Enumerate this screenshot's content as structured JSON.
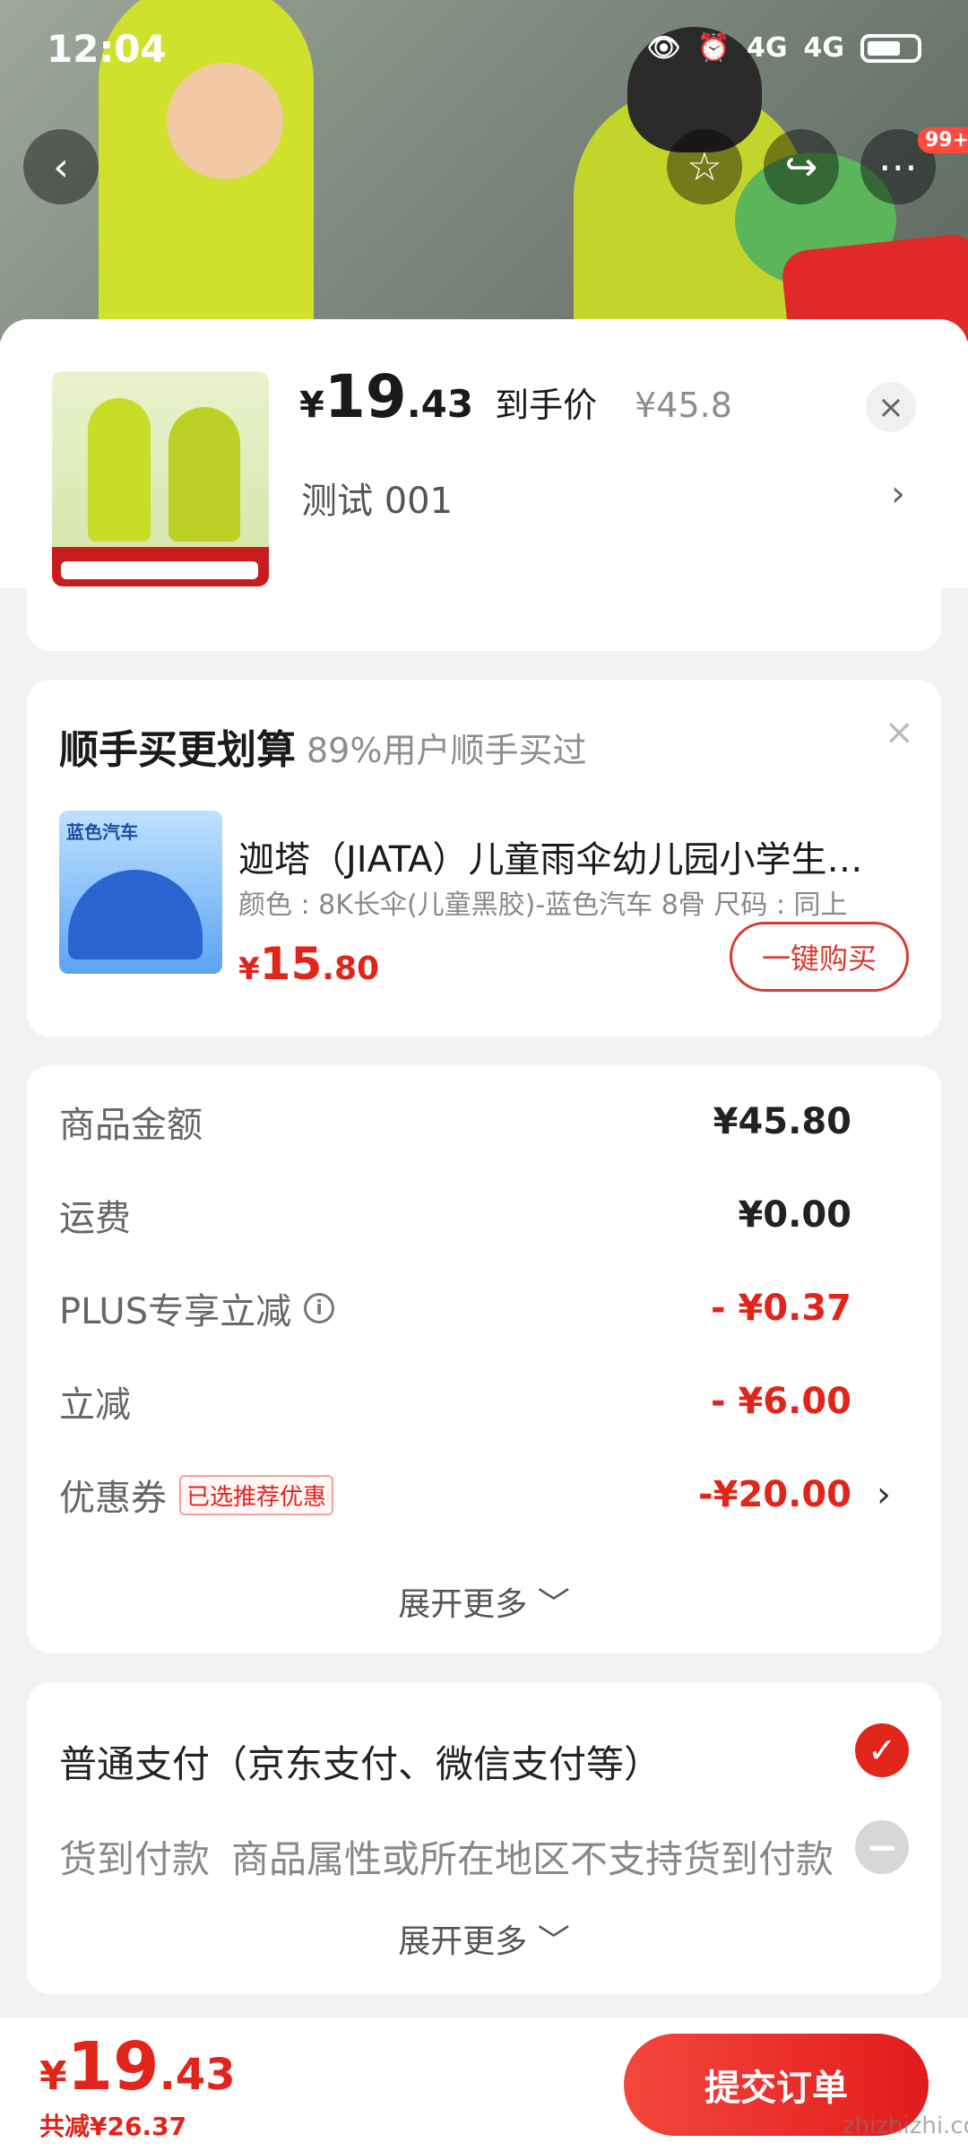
{
  "status_bar": {
    "time": "12:04",
    "network1": "4G",
    "network2": "4G"
  },
  "header": {
    "notification_badge": "99+"
  },
  "product": {
    "yen": "¥",
    "price_int": "19",
    "price_dec": ".43",
    "price_label": "到手价",
    "original_price": "¥45.8",
    "spec": "测试  001",
    "close": "×",
    "spec_arrow": "›"
  },
  "upsell": {
    "title": "顺手买更划算",
    "subtitle": "89%用户顺手买过",
    "close": "×",
    "image_text": "蓝色汽车",
    "name": "迦塔（JIATA）儿童雨伞幼儿园小学生黑…",
    "spec": "颜色 : 8K长伞(儿童黑胶)-蓝色汽车 8骨    尺码 : 同上",
    "price_yen": "¥",
    "price_int": "15",
    "price_dec": ".80",
    "buy_button": "一键购买"
  },
  "summary": {
    "rows": [
      {
        "label": "商品金额",
        "value": "¥45.80"
      },
      {
        "label": "运费",
        "value": "¥0.00"
      },
      {
        "label": "PLUS专享立减",
        "value": "- ¥0.37"
      },
      {
        "label": "立减",
        "value": "- ¥6.00"
      },
      {
        "label": "优惠券",
        "tag": "已选推荐优惠",
        "value": "-¥20.00"
      }
    ],
    "expand": "展开更多 ﹀"
  },
  "payment": {
    "main": "普通支付（京东支付、微信支付等）",
    "cod_label": "货到付款",
    "cod_note": "商品属性或所在地区不支持货到付款",
    "expand": "展开更多 ﹀"
  },
  "footer": {
    "yen": "¥",
    "total_int": "19",
    "total_dec": ".43",
    "saved": "共减¥26.37",
    "submit": "提交订单",
    "watermark": "zhizhizhi.com"
  }
}
